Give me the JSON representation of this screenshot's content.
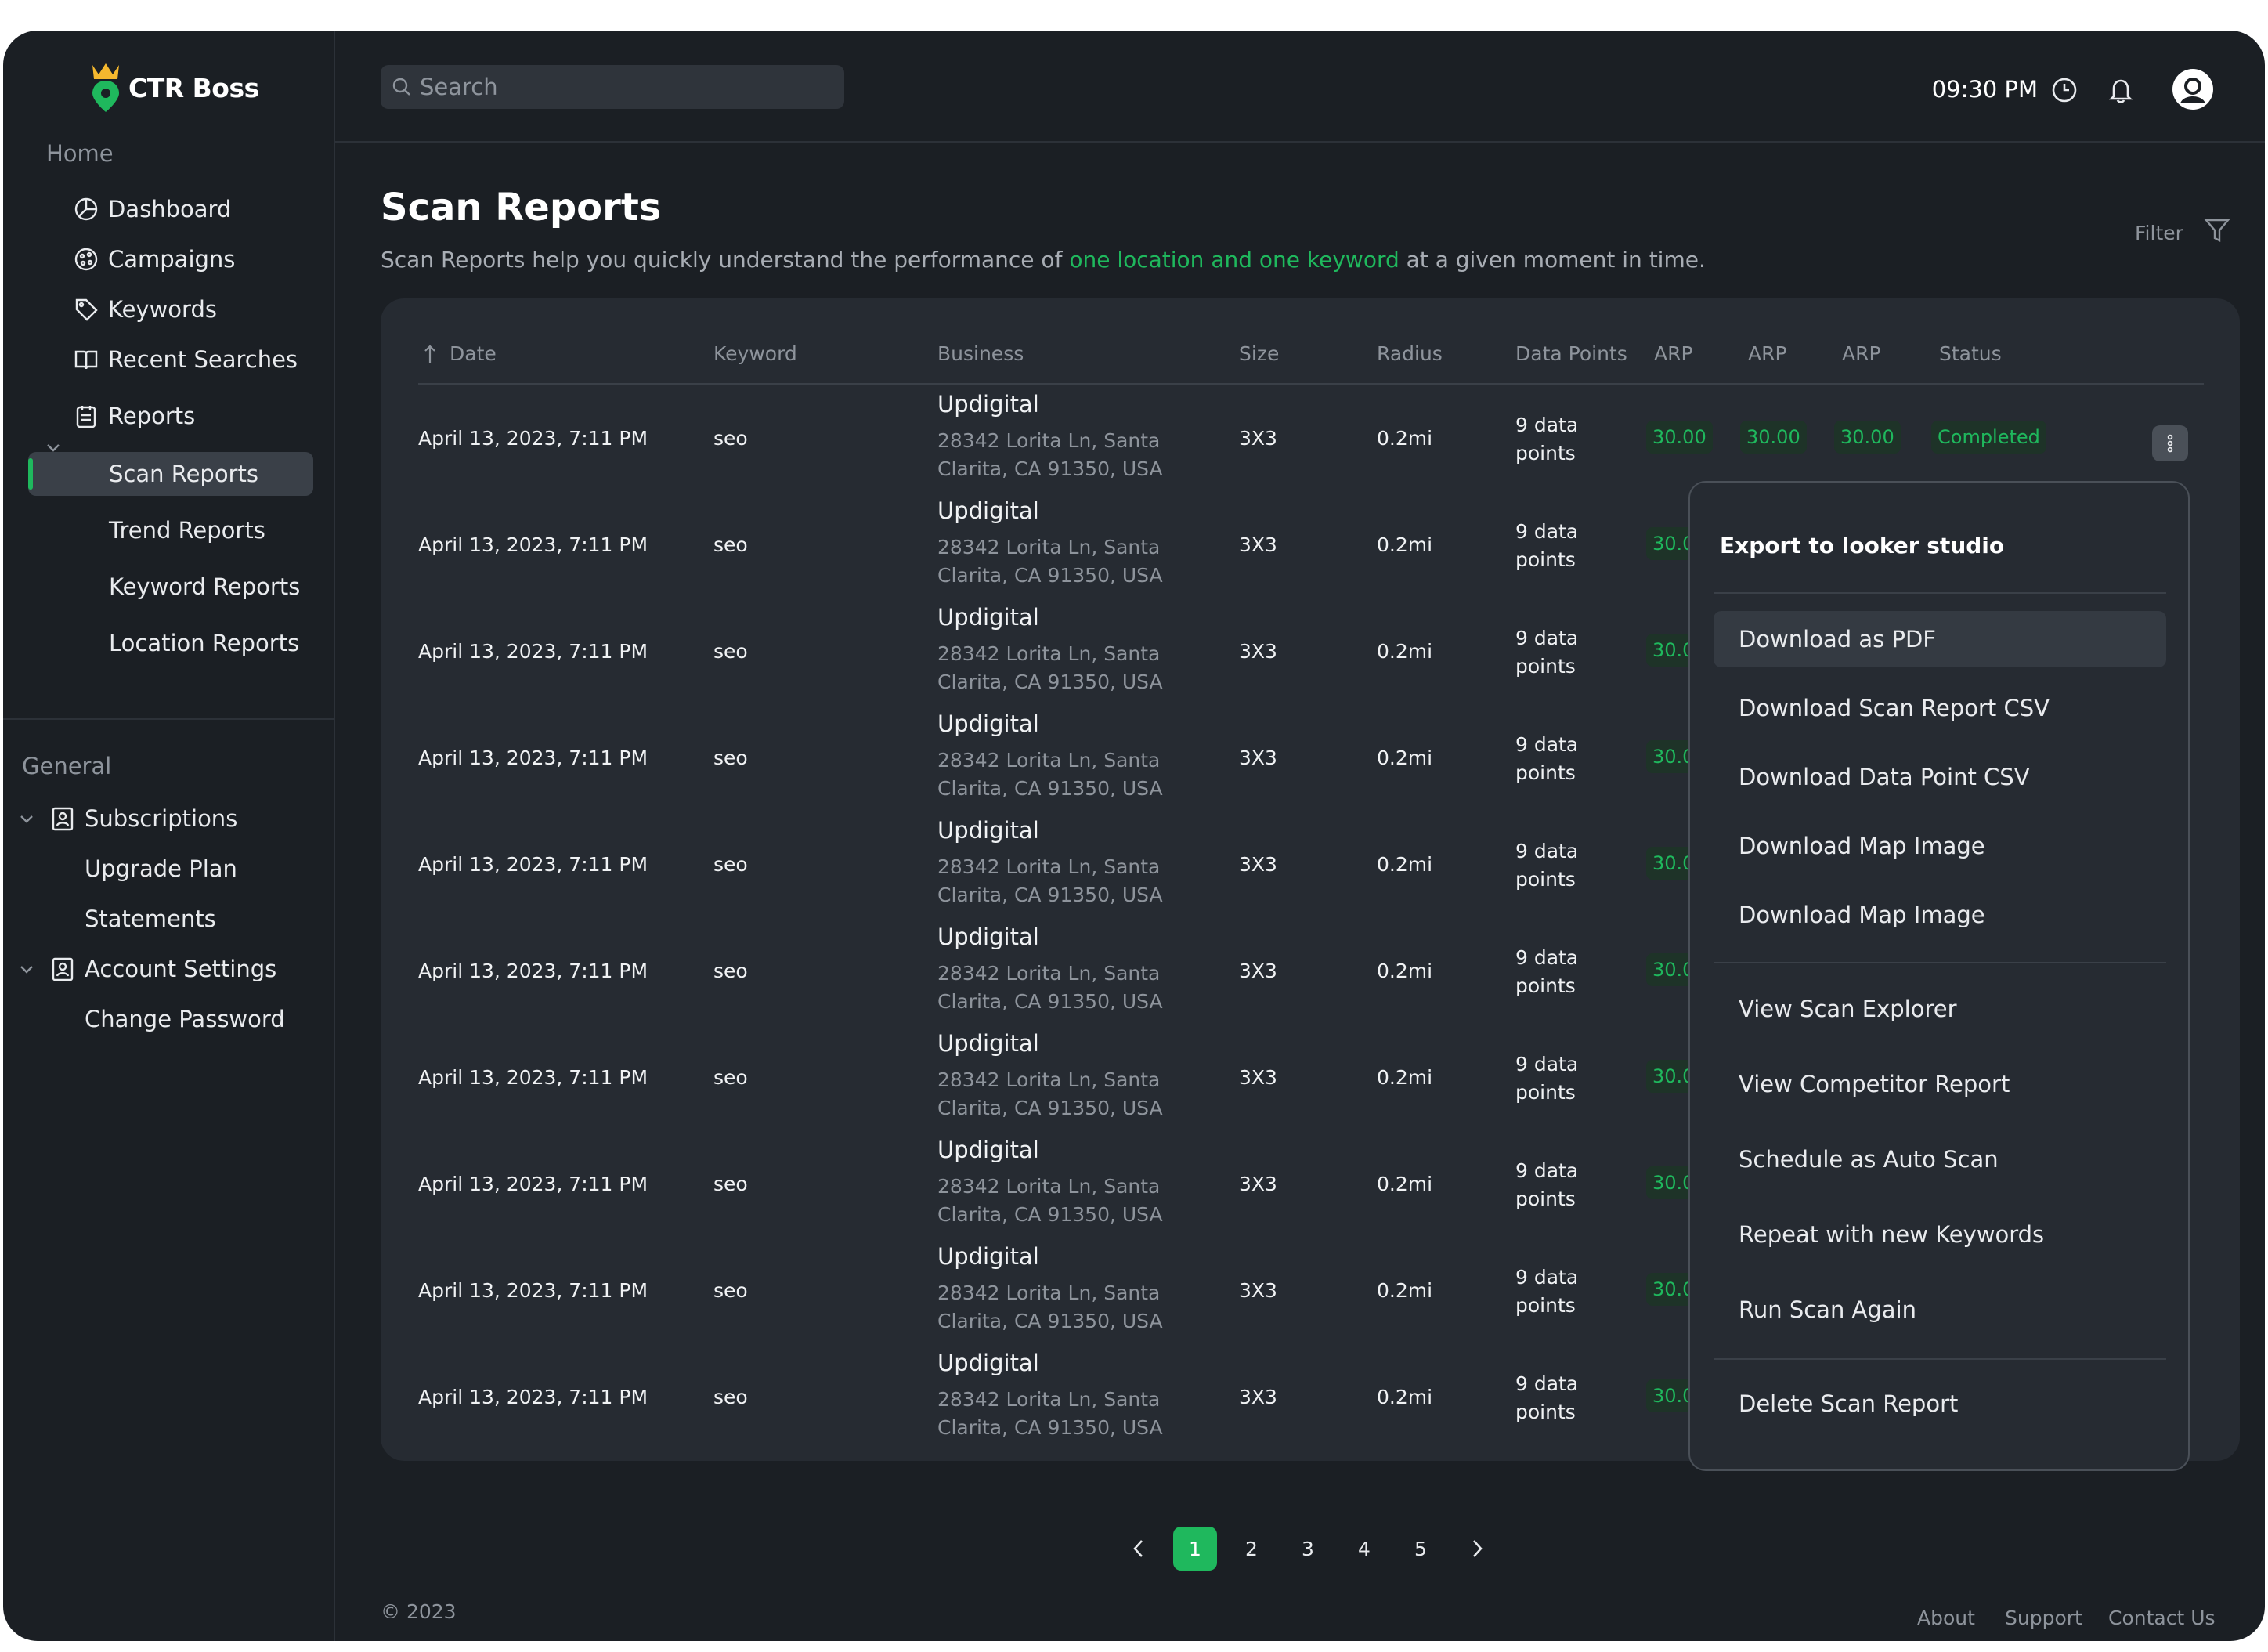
{
  "app": {
    "name": "CTR Boss"
  },
  "sidebar": {
    "home_label": "Home",
    "general_label": "General",
    "home_items": [
      {
        "label": "Dashboard",
        "icon": "dashboard-icon"
      },
      {
        "label": "Campaigns",
        "icon": "campaigns-icon"
      },
      {
        "label": "Keywords",
        "icon": "tag-icon"
      },
      {
        "label": "Recent Searches",
        "icon": "book-icon"
      },
      {
        "label": "Reports",
        "icon": "clipboard-icon"
      }
    ],
    "report_items": [
      {
        "label": "Scan Reports",
        "active": true
      },
      {
        "label": "Trend Reports"
      },
      {
        "label": "Keyword Reports"
      },
      {
        "label": "Location Reports"
      }
    ],
    "general_items": [
      {
        "label": "Subscriptions",
        "icon": "badge-icon"
      },
      {
        "label": "Upgrade Plan"
      },
      {
        "label": "Statements"
      },
      {
        "label": "Account Settings",
        "icon": "badge-icon"
      },
      {
        "label": "Change Password"
      }
    ]
  },
  "topbar": {
    "search_placeholder": "Search",
    "time": "09:30 PM"
  },
  "main": {
    "title": "Scan Reports",
    "subtitle_before": "Scan Reports help you quickly understand the performance of ",
    "subtitle_highlight": "one location and one keyword",
    "subtitle_after": " at a given moment in time.",
    "filter_label": "Filter"
  },
  "table": {
    "columns": [
      "Date",
      "Keyword",
      "Business",
      "Size",
      "Radius",
      "Data Points",
      "ARP",
      "ARP",
      "ARP",
      "Status"
    ],
    "rows": [
      {
        "date": "April 13, 2023, 7:11 PM",
        "keyword": "seo",
        "business": "Updigital",
        "address": "28342 Lorita Ln, Santa Clarita, CA 91350, USA",
        "size": "3X3",
        "radius": "0.2mi",
        "data_points": "9 data points",
        "arp1": "30.00",
        "arp2": "30.00",
        "arp3": "30.00",
        "status": "Completed"
      },
      {
        "date": "April 13, 2023, 7:11 PM",
        "keyword": "seo",
        "business": "Updigital",
        "address": "28342 Lorita Ln, Santa Clarita, CA 91350, USA",
        "size": "3X3",
        "radius": "0.2mi",
        "data_points": "9 data points",
        "arp1": "30.00"
      },
      {
        "date": "April 13, 2023, 7:11 PM",
        "keyword": "seo",
        "business": "Updigital",
        "address": "28342 Lorita Ln, Santa Clarita, CA 91350, USA",
        "size": "3X3",
        "radius": "0.2mi",
        "data_points": "9 data points",
        "arp1": "30.00"
      },
      {
        "date": "April 13, 2023, 7:11 PM",
        "keyword": "seo",
        "business": "Updigital",
        "address": "28342 Lorita Ln, Santa Clarita, CA 91350, USA",
        "size": "3X3",
        "radius": "0.2mi",
        "data_points": "9 data points",
        "arp1": "30.00"
      },
      {
        "date": "April 13, 2023, 7:11 PM",
        "keyword": "seo",
        "business": "Updigital",
        "address": "28342 Lorita Ln, Santa Clarita, CA 91350, USA",
        "size": "3X3",
        "radius": "0.2mi",
        "data_points": "9 data points",
        "arp1": "30.00"
      },
      {
        "date": "April 13, 2023, 7:11 PM",
        "keyword": "seo",
        "business": "Updigital",
        "address": "28342 Lorita Ln, Santa Clarita, CA 91350, USA",
        "size": "3X3",
        "radius": "0.2mi",
        "data_points": "9 data points",
        "arp1": "30.00"
      },
      {
        "date": "April 13, 2023, 7:11 PM",
        "keyword": "seo",
        "business": "Updigital",
        "address": "28342 Lorita Ln, Santa Clarita, CA 91350, USA",
        "size": "3X3",
        "radius": "0.2mi",
        "data_points": "9 data points",
        "arp1": "30.00"
      },
      {
        "date": "April 13, 2023, 7:11 PM",
        "keyword": "seo",
        "business": "Updigital",
        "address": "28342 Lorita Ln, Santa Clarita, CA 91350, USA",
        "size": "3X3",
        "radius": "0.2mi",
        "data_points": "9 data points",
        "arp1": "30.00"
      },
      {
        "date": "April 13, 2023, 7:11 PM",
        "keyword": "seo",
        "business": "Updigital",
        "address": "28342 Lorita Ln, Santa Clarita, CA 91350, USA",
        "size": "3X3",
        "radius": "0.2mi",
        "data_points": "9 data points",
        "arp1": "30.00"
      },
      {
        "date": "April 13, 2023, 7:11 PM",
        "keyword": "seo",
        "business": "Updigital",
        "address": "28342 Lorita Ln, Santa Clarita, CA 91350, USA",
        "size": "3X3",
        "radius": "0.2mi",
        "data_points": "9 data points",
        "arp1": "30.00"
      }
    ]
  },
  "menu": {
    "title": "Export to looker studio",
    "group1": [
      "Download as PDF",
      "Download Scan Report CSV",
      "Download Data Point CSV",
      "Download Map Image",
      "Download Map Image"
    ],
    "group2": [
      "View Scan Explorer",
      "View Competitor Report",
      "Schedule as Auto Scan",
      "Repeat with new Keywords",
      "Run Scan Again"
    ],
    "group3": [
      "Delete Scan Report"
    ]
  },
  "pagination": {
    "pages": [
      "1",
      "2",
      "3",
      "4",
      "5"
    ],
    "current": "1"
  },
  "footer": {
    "copyright": "© 2023",
    "links": [
      "About",
      "Support",
      "Contact Us"
    ]
  },
  "colors": {
    "accent": "#1fb85d",
    "background": "#1b1f24",
    "card": "#262b32",
    "logo_yellow": "#f5b82e"
  }
}
